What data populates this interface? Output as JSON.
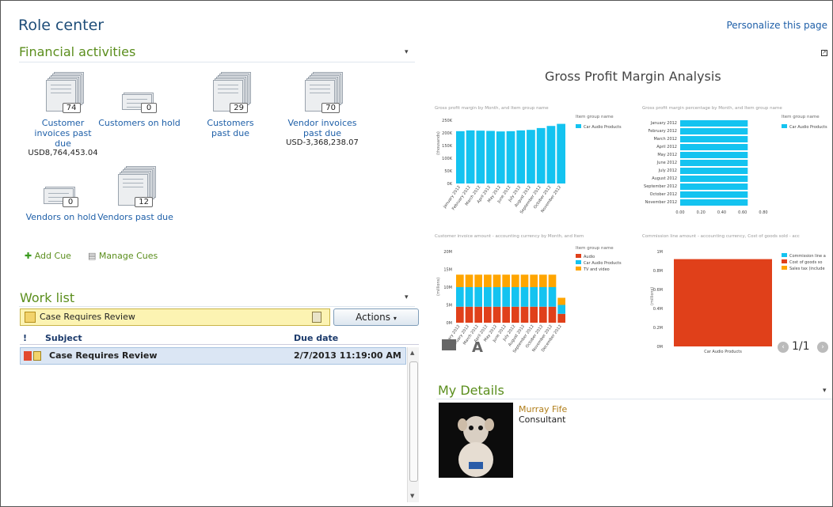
{
  "header": {
    "title": "Role center",
    "personalize": "Personalize this page"
  },
  "financial": {
    "title": "Financial activities",
    "cues": [
      {
        "count": "74",
        "label": "Customer invoices past due",
        "value": "USD8,764,453.04"
      },
      {
        "count": "0",
        "label": "Customers on hold",
        "value": ""
      },
      {
        "count": "29",
        "label": "Customers past due",
        "value": ""
      },
      {
        "count": "70",
        "label": "Vendor invoices past due",
        "value": "USD-3,368,238.07"
      },
      {
        "count": "0",
        "label": "Vendors on hold",
        "value": ""
      },
      {
        "count": "12",
        "label": "Vendors past due",
        "value": ""
      }
    ],
    "add_cue": "Add Cue",
    "manage_cues": "Manage Cues"
  },
  "worklist": {
    "title": "Work list",
    "filter": "Case Requires Review",
    "actions": "Actions",
    "columns": {
      "flag": "!",
      "subject": "Subject",
      "due": "Due date"
    },
    "rows": [
      {
        "subject": "Case Requires Review",
        "due": "2/7/2013 11:19:00 AM"
      }
    ]
  },
  "analysis": {
    "title": "Gross Profit Margin Analysis",
    "pager": "1/1"
  },
  "details": {
    "title": "My Details",
    "name": "Murray Fife",
    "role": "Consultant"
  },
  "colors": {
    "cyan": "#14c3f0",
    "red": "#e0401a",
    "orange": "#ffa500",
    "green": "#5b8e1d",
    "link": "#1e5fa8"
  },
  "chart_data": [
    {
      "type": "bar",
      "title": "Gross profit margin by Month, and Item group name",
      "legend_title": "Item group name",
      "ylabel": "(thousands)",
      "categories": [
        "January 2012",
        "February 2012",
        "March 2012",
        "April 2012",
        "May 2012",
        "June 2012",
        "July 2012",
        "August 2012",
        "September 2012",
        "October 2012",
        "November 2012"
      ],
      "yticks": [
        "0K",
        "50K",
        "100K",
        "150K",
        "200K",
        "250K"
      ],
      "ylim": [
        0,
        260000
      ],
      "series": [
        {
          "name": "Car Audio Products",
          "values": [
            200000,
            203000,
            202000,
            201000,
            199000,
            200000,
            203000,
            205000,
            212000,
            220000,
            228000
          ]
        }
      ]
    },
    {
      "type": "bar",
      "orientation": "horizontal",
      "title": "Gross profit margin percentage by Month, and Item group name",
      "legend_title": "Item group name",
      "categories": [
        "January 2012",
        "February 2012",
        "March 2012",
        "April 2012",
        "May 2012",
        "June 2012",
        "July 2012",
        "August 2012",
        "September 2012",
        "October 2012",
        "November 2012"
      ],
      "xticks": [
        "0.00",
        "0.20",
        "0.40",
        "0.60",
        "0.80"
      ],
      "xlim": [
        0,
        0.8
      ],
      "series": [
        {
          "name": "Car Audio Products",
          "values": [
            0.65,
            0.65,
            0.65,
            0.65,
            0.65,
            0.65,
            0.65,
            0.65,
            0.65,
            0.65,
            0.65
          ]
        }
      ]
    },
    {
      "type": "bar",
      "stacked": true,
      "title": "Customer invoice amount - accounting currency by Month, and Item group name",
      "legend_title": "Item group name",
      "ylabel": "(millions)",
      "categories": [
        "January 2012",
        "February 2012",
        "March 2012",
        "April 2012",
        "May 2012",
        "June 2012",
        "July 2012",
        "August 2012",
        "September 2012",
        "October 2012",
        "November 2012",
        "December 2012"
      ],
      "yticks": [
        "0M",
        "5M",
        "10M",
        "15M",
        "20M"
      ],
      "ylim": [
        0,
        20
      ],
      "series": [
        {
          "name": "Audio",
          "values": [
            4.5,
            4.5,
            4.5,
            4.5,
            4.5,
            4.5,
            4.5,
            4.5,
            4.5,
            4.5,
            4.5,
            2.5
          ]
        },
        {
          "name": "Car Audio Products",
          "values": [
            5.5,
            5.5,
            5.5,
            5.5,
            5.5,
            5.5,
            5.5,
            5.5,
            5.5,
            5.5,
            5.5,
            2.5
          ]
        },
        {
          "name": "TV and video",
          "values": [
            3.5,
            3.5,
            3.5,
            3.5,
            3.5,
            3.5,
            3.5,
            3.5,
            3.5,
            3.5,
            3.5,
            2
          ]
        }
      ]
    },
    {
      "type": "bar",
      "stacked": true,
      "title": "Commission line amount - accounting currency, Cost of goods sold - acc",
      "ylabel": "(millions)",
      "categories": [
        "Car Audio Products"
      ],
      "yticks": [
        "0M",
        "0.2M",
        "0.4M",
        "0.6M",
        "0.8M",
        "1M"
      ],
      "ylim": [
        0,
        1
      ],
      "series": [
        {
          "name": "Commission line a",
          "values": [
            0
          ]
        },
        {
          "name": "Cost of goods so",
          "values": [
            0.92
          ]
        },
        {
          "name": "Sales tax (include",
          "values": [
            0
          ]
        }
      ]
    }
  ]
}
